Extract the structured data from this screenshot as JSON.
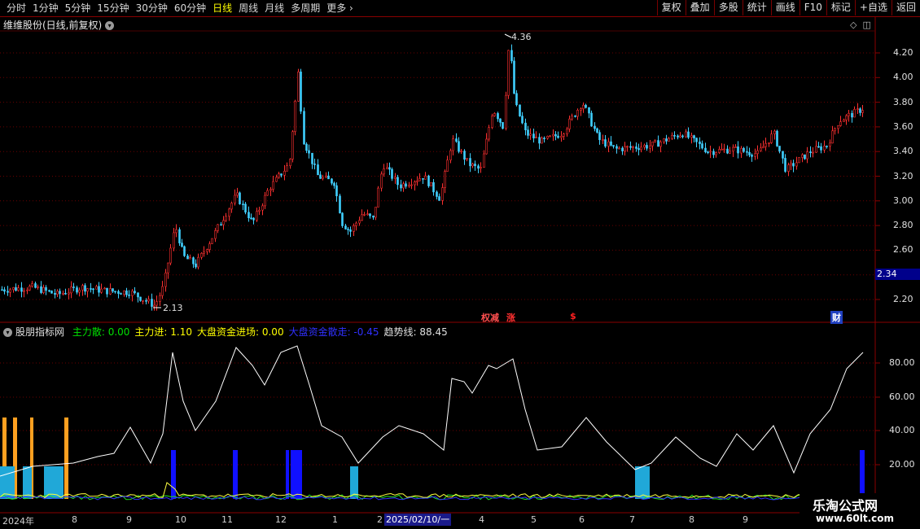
{
  "toolbar": {
    "periods": [
      "分时",
      "1分钟",
      "5分钟",
      "15分钟",
      "30分钟",
      "60分钟",
      "日线",
      "周线",
      "月线",
      "多周期",
      "更多"
    ],
    "active_period": "日线",
    "right_buttons": [
      "复权",
      "叠加",
      "多股",
      "统计",
      "画线",
      "F10",
      "标记",
      "+自选",
      "返回"
    ]
  },
  "main_chart": {
    "title": "维维股份(日线,前复权)",
    "y_ticks": [
      "4.20",
      "4.00",
      "3.80",
      "3.60",
      "3.40",
      "3.20",
      "3.00",
      "2.80",
      "2.60",
      "2.40",
      "2.20"
    ],
    "high_label": "4.36",
    "low_label": "2.13",
    "current_price": "2.34",
    "signals": [
      {
        "text": "权减",
        "color": "#ff5050"
      },
      {
        "text": "涨",
        "color": "#ff3030"
      },
      {
        "text": "$",
        "color": "#ff2020"
      },
      {
        "text": "财",
        "color": "#ffffff"
      }
    ]
  },
  "indicator": {
    "name": "股朋指标网",
    "items": [
      {
        "label": "主力散:",
        "value": "0.00",
        "color": "#00e000"
      },
      {
        "label": "主力进:",
        "value": "1.10",
        "color": "#ffff00"
      },
      {
        "label": "大盘资金进场:",
        "value": "0.00",
        "color": "#ffff00"
      },
      {
        "label": "大盘资金散走:",
        "value": "-0.45",
        "color": "#3030ff"
      },
      {
        "label": "趋势线:",
        "value": "88.45",
        "color": "#e0e0e0"
      }
    ],
    "y_ticks": [
      "80.00",
      "60.00",
      "40.00",
      "20.00"
    ]
  },
  "date_axis": {
    "labels": [
      "2024年",
      "8",
      "9",
      "10",
      "11",
      "12",
      "1",
      "2",
      "",
      "4",
      "5",
      "6",
      "7",
      "8",
      "9"
    ],
    "highlight": "2025/02/10/一"
  },
  "logo": {
    "line1": "乐淘公式网",
    "line2": "www.60lt.com"
  },
  "colors": {
    "up": "#ff3030",
    "down": "#40d0ff",
    "grid": "#6a0000",
    "trend": "#ffffff",
    "bar_orange": "#ffa020",
    "bar_cyan": "#20a8d8",
    "bar_blue": "#1010ff"
  }
}
